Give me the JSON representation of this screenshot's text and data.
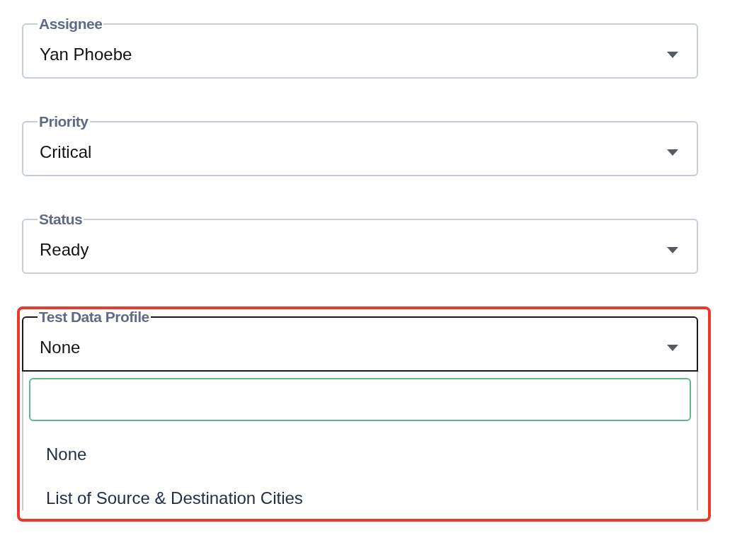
{
  "fields": [
    {
      "label": "Assignee",
      "value": "Yan Phoebe",
      "open": false,
      "highlighted": false
    },
    {
      "label": "Priority",
      "value": "Critical",
      "open": false,
      "highlighted": false
    },
    {
      "label": "Status",
      "value": "Ready",
      "open": false,
      "highlighted": false
    },
    {
      "label": "Test Data Profile",
      "value": "None",
      "open": true,
      "highlighted": true,
      "options": [
        "None",
        "List of Source & Destination Cities"
      ]
    }
  ]
}
